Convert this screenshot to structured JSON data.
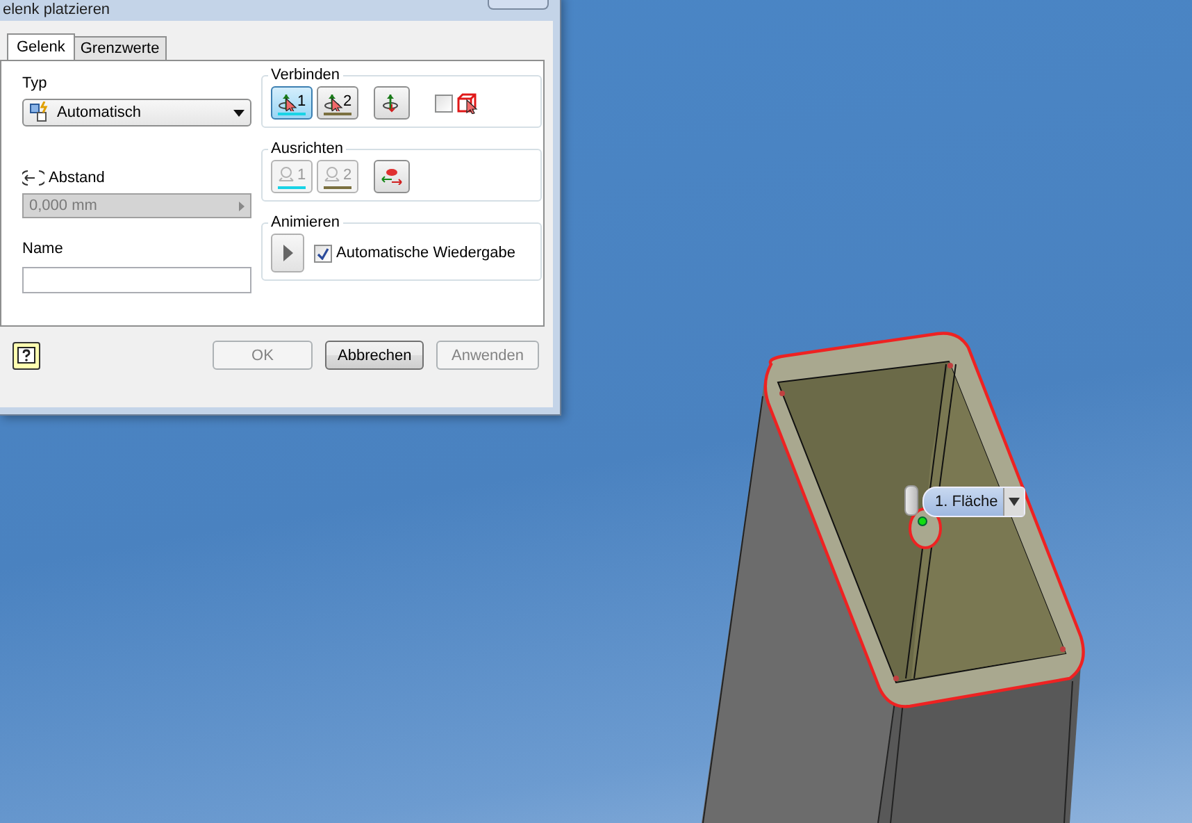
{
  "window": {
    "title": "elenk platzieren"
  },
  "tabs": [
    {
      "label": "Gelenk",
      "selected": true
    },
    {
      "label": "Grenzwerte",
      "selected": false
    }
  ],
  "type": {
    "label": "Typ",
    "value": "Automatisch"
  },
  "distance": {
    "label": "Abstand",
    "value": "0,000 mm",
    "disabled": true
  },
  "name": {
    "label": "Name"
  },
  "connect": {
    "title": "Verbinden",
    "buttons": [
      {
        "label": "1",
        "selected": true
      },
      {
        "label": "2",
        "selected": false
      }
    ],
    "checked": false
  },
  "align": {
    "title": "Ausrichten",
    "buttons": [
      {
        "label": "1",
        "disabled": true
      },
      {
        "label": "2",
        "disabled": true
      }
    ]
  },
  "animate": {
    "title": "Animieren",
    "checkbox": {
      "label": "Automatische Wiedergabe",
      "checked": true
    }
  },
  "buttons": [
    {
      "label": "OK",
      "disabled": true
    },
    {
      "label": "Abbrechen",
      "disabled": false
    },
    {
      "label": "Anwenden",
      "disabled": true
    }
  ],
  "viewport": {
    "tooltip": "1. Fläche"
  }
}
